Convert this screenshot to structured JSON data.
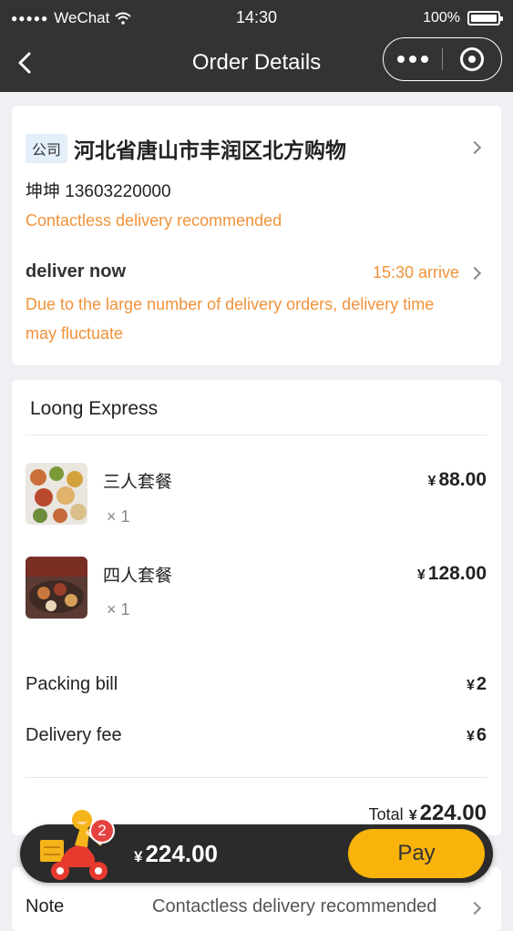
{
  "status_bar": {
    "carrier": "WeChat",
    "time": "14:30",
    "battery": "100%"
  },
  "nav": {
    "title": "Order Details"
  },
  "address": {
    "tag": "公司",
    "text": "河北省唐山市丰润区北方购物",
    "contact": "坤坤 13603220000",
    "contactless": "Contactless delivery recommended",
    "deliver_label": "deliver now",
    "arrive_text": "15:30 arrive",
    "fluctuate_note": "Due to the large number of delivery orders, delivery time may fluctuate"
  },
  "order": {
    "shop_name": "Loong Express",
    "currency": "¥",
    "items": [
      {
        "name": "三人套餐",
        "qty": "× 1",
        "price": "88.00",
        "image": "three-person-meal-photo"
      },
      {
        "name": "四人套餐",
        "qty": "× 1",
        "price": "128.00",
        "image": "four-person-meal-photo"
      }
    ],
    "packing_label": "Packing bill",
    "packing_value": "2",
    "delivery_label": "Delivery fee",
    "delivery_value": "6",
    "total_label": "Total",
    "total_value": "224.00"
  },
  "note": {
    "label": "Note",
    "value": "Contactless delivery recommended"
  },
  "paybar": {
    "cart_count": "2",
    "total": "224.00",
    "pay_label": "Pay"
  },
  "colors": {
    "accent_orange": "#f0923a",
    "pay_yellow": "#f9b40b",
    "header_bg": "#333333",
    "badge_red": "#e64340"
  }
}
